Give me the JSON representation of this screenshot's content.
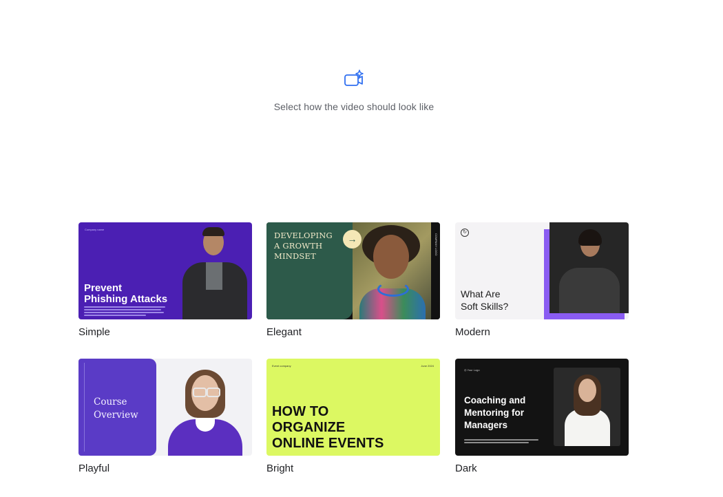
{
  "header": {
    "icon": "sparkle-video-icon",
    "subtitle": "Select how the video should look like"
  },
  "colors": {
    "accent_icon": "#2f6ff0"
  },
  "styles": [
    {
      "label": "Simple",
      "thumb": {
        "brand": "Company name",
        "title_line1": "Prevent",
        "title_line2": "Phishing Attacks"
      }
    },
    {
      "label": "Elegant",
      "thumb": {
        "title_line1": "DEVELOPING",
        "title_line2": "A GROWTH",
        "title_line3": "MINDSET",
        "side_text": "COMPANY LOGO",
        "arrow": "→"
      }
    },
    {
      "label": "Modern",
      "thumb": {
        "title_line1": "What Are",
        "title_line2": "Soft Skills?"
      }
    },
    {
      "label": "Playful",
      "thumb": {
        "title_line1": "Course",
        "title_line2": "Overview"
      }
    },
    {
      "label": "Bright",
      "thumb": {
        "small_left": "Event company",
        "small_right": "June 2024",
        "title_line1": "HOW TO",
        "title_line2": "ORGANIZE",
        "title_line3": "ONLINE EVENTS"
      }
    },
    {
      "label": "Dark",
      "thumb": {
        "logo": "Your Logo",
        "title_line1": "Coaching and",
        "title_line2": "Mentoring for",
        "title_line3": "Managers"
      }
    }
  ]
}
